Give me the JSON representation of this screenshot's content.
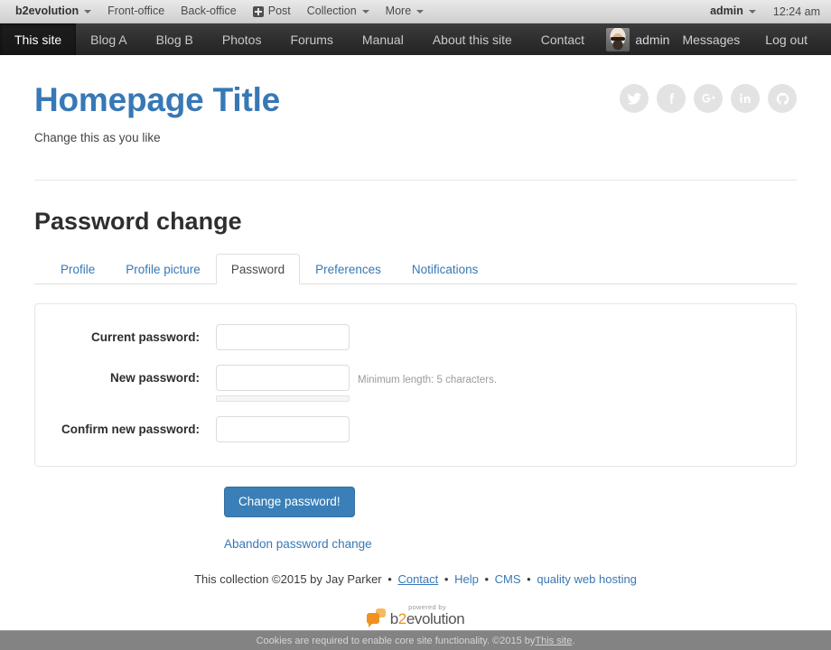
{
  "evobar": {
    "left_items": [
      {
        "label": "b2evolution",
        "caret": true,
        "brand": true,
        "icon": null
      },
      {
        "label": "Front-office",
        "caret": false,
        "brand": false,
        "icon": null
      },
      {
        "label": "Back-office",
        "caret": false,
        "brand": false,
        "icon": null
      },
      {
        "label": "Post",
        "caret": false,
        "brand": false,
        "icon": "plus-square-icon"
      },
      {
        "label": "Collection",
        "caret": true,
        "brand": false,
        "icon": null
      },
      {
        "label": "More",
        "caret": true,
        "brand": false,
        "icon": null
      }
    ],
    "user_label": "admin",
    "time": "12:24 am"
  },
  "navbar": {
    "items": [
      {
        "label": "This site",
        "active": true
      },
      {
        "label": "Blog A",
        "active": false
      },
      {
        "label": "Blog B",
        "active": false
      },
      {
        "label": "Photos",
        "active": false
      },
      {
        "label": "Forums",
        "active": false
      },
      {
        "label": "Manual",
        "active": false
      },
      {
        "label": "About this site",
        "active": false
      },
      {
        "label": "Contact",
        "active": false
      }
    ],
    "username": "admin",
    "messages_label": "Messages",
    "logout_label": "Log out"
  },
  "site_header": {
    "title": "Homepage Title",
    "tagline": "Change this as you like",
    "social": [
      {
        "name": "twitter-icon"
      },
      {
        "name": "facebook-icon"
      },
      {
        "name": "google-plus-icon"
      },
      {
        "name": "linkedin-icon"
      },
      {
        "name": "github-icon"
      }
    ]
  },
  "main": {
    "page_title": "Password change",
    "tabs": [
      {
        "label": "Profile",
        "active": false
      },
      {
        "label": "Profile picture",
        "active": false
      },
      {
        "label": "Password",
        "active": true
      },
      {
        "label": "Preferences",
        "active": false
      },
      {
        "label": "Notifications",
        "active": false
      }
    ],
    "form": {
      "fields": [
        {
          "label": "Current password:",
          "value": "",
          "placeholder": "",
          "note": "",
          "strength_bar": false
        },
        {
          "label": "New password:",
          "value": "",
          "placeholder": "",
          "note": "Minimum length: 5 characters.",
          "strength_bar": true
        },
        {
          "label": "Confirm new password:",
          "value": "",
          "placeholder": "",
          "note": "",
          "strength_bar": false
        }
      ],
      "submit_label": "Change password!",
      "abandon_label": "Abandon password change"
    }
  },
  "footer": {
    "copyright": "This collection ©2015 by Jay Parker",
    "links": [
      {
        "label": "Contact",
        "underlined": true
      },
      {
        "label": "Help",
        "underlined": false
      },
      {
        "label": "CMS",
        "underlined": false
      },
      {
        "label": "quality web hosting",
        "underlined": false
      }
    ],
    "separator": "•",
    "powered_by_top": "powered by",
    "powered_by_name_1": "b",
    "powered_by_name_accent": "2",
    "powered_by_name_2": "evolution"
  },
  "cookie_bar": {
    "text_before": "Cookies are required to enable core site functionality. ©2015 by ",
    "link_label": "This site",
    "text_after": "."
  },
  "colors": {
    "brand_blue": "#3778b5",
    "button_blue": "#3a7fb8",
    "navbar_dark": "#2b2b2b",
    "evobar_gray": "#dcdcdc",
    "accent_orange": "#f0901e",
    "cookie_bar_gray": "#838383"
  }
}
